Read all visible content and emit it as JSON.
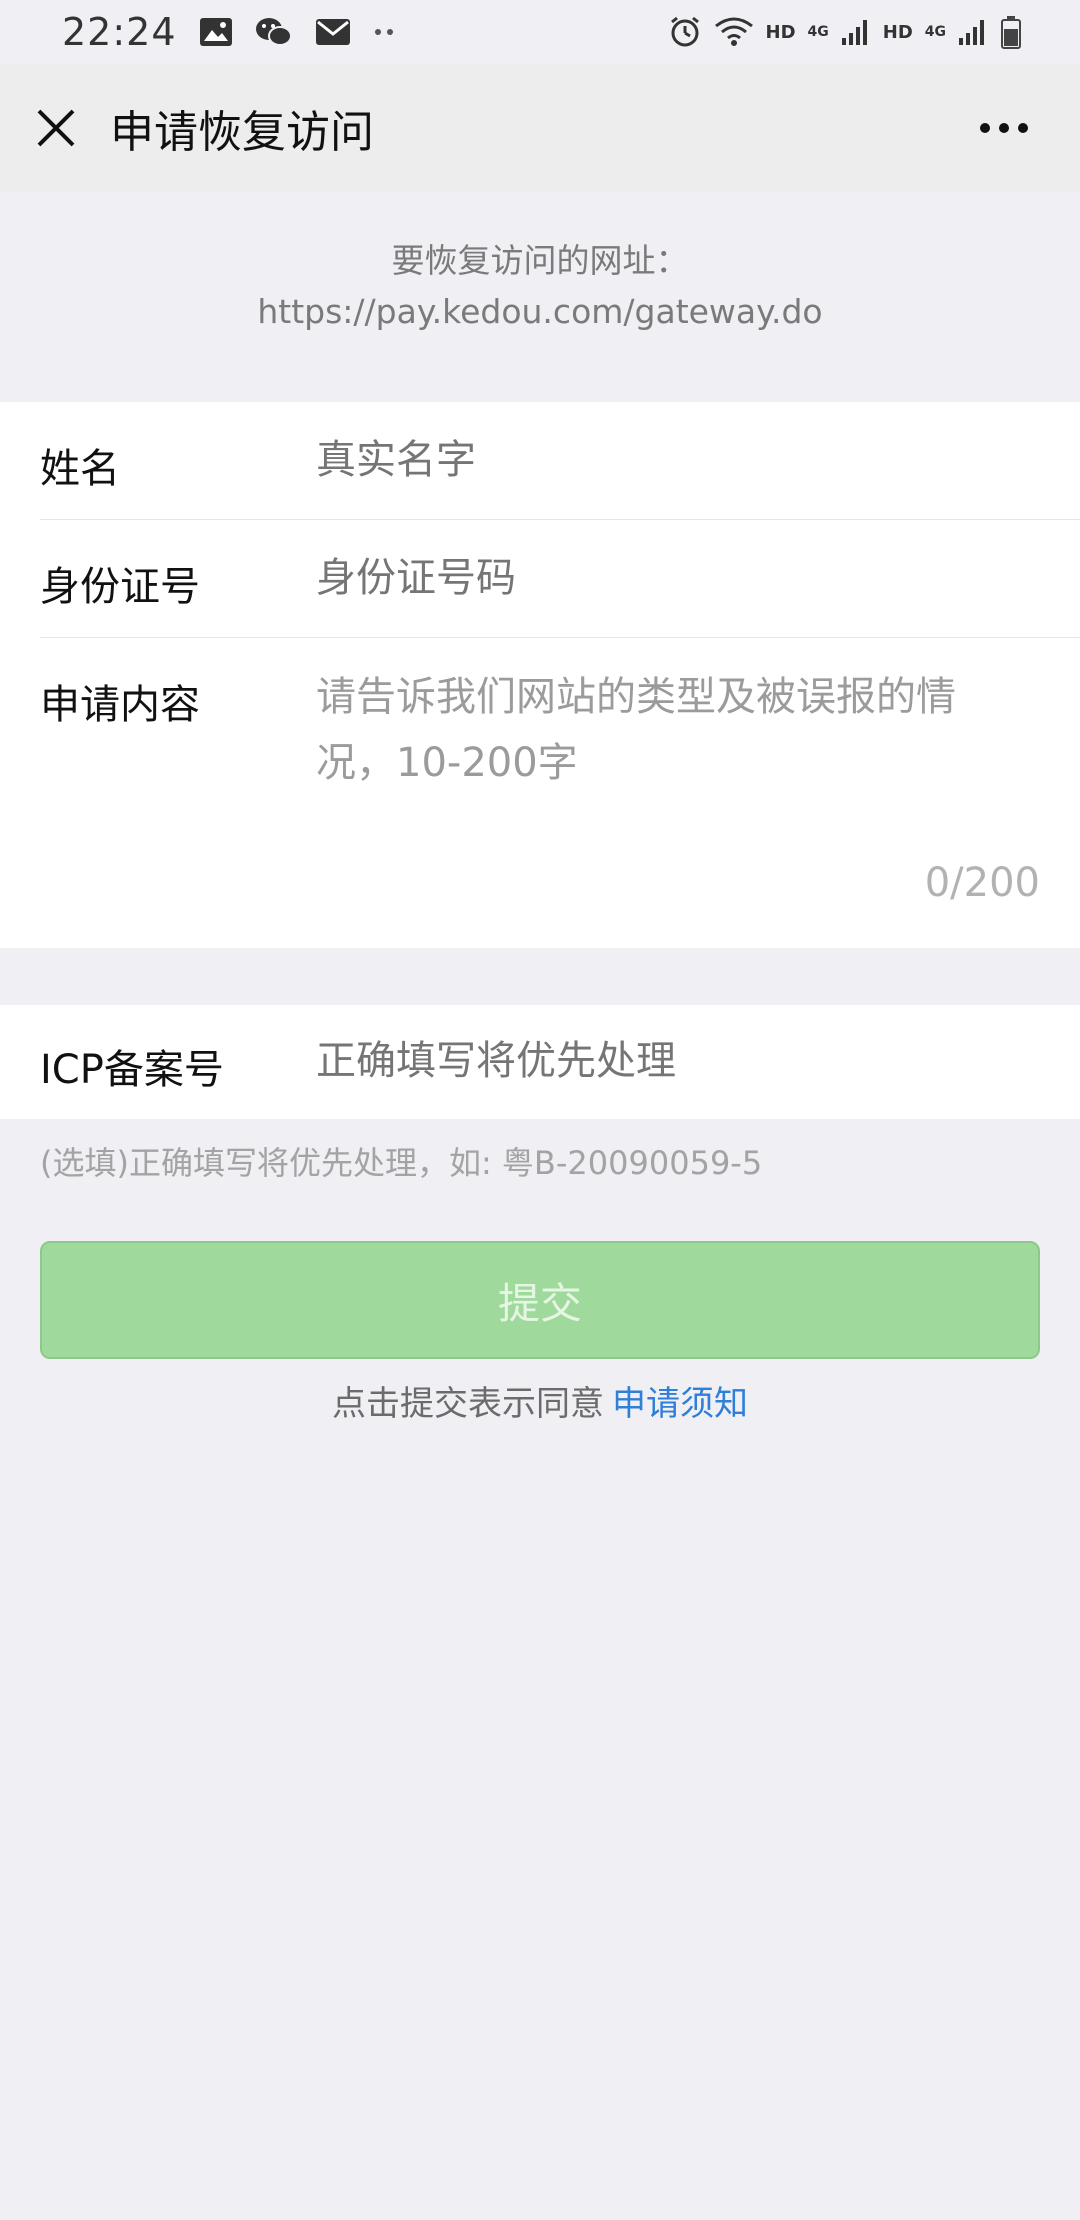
{
  "status_bar": {
    "time": "22:24",
    "icons": [
      "image-icon",
      "wechat-icon",
      "mail-icon",
      "more-dots-icon",
      "alarm-icon",
      "wifi-icon",
      "signal-icon",
      "signal-icon-2",
      "battery-icon"
    ],
    "network": {
      "hd1": "HD",
      "g1": "4G",
      "hd2": "HD",
      "g2": "4G"
    }
  },
  "nav": {
    "title": "申请恢复访问",
    "close_icon": "close-icon",
    "more_icon": "more-icon"
  },
  "url_info": {
    "label": "要恢复访问的网址：",
    "url": "https://pay.kedou.com/gateway.do"
  },
  "form": {
    "name": {
      "label": "姓名",
      "placeholder": "真实名字"
    },
    "id_number": {
      "label": "身份证号",
      "placeholder": "身份证号码"
    },
    "content": {
      "label": "申请内容",
      "placeholder": "请告诉我们网站的类型及被误报的情况，10-200字",
      "counter": "0/200"
    },
    "icp": {
      "label": "ICP备案号",
      "placeholder": "正确填写将优先处理"
    },
    "icp_hint": "(选填)正确填写将优先处理，如: 粤B-20090059-5"
  },
  "submit": {
    "label": "提交",
    "agree_text": "点击提交表示同意",
    "agree_link": "申请须知"
  },
  "colors": {
    "background": "#efeff4",
    "button": "#9fd99b",
    "link": "#2f7ed8"
  }
}
